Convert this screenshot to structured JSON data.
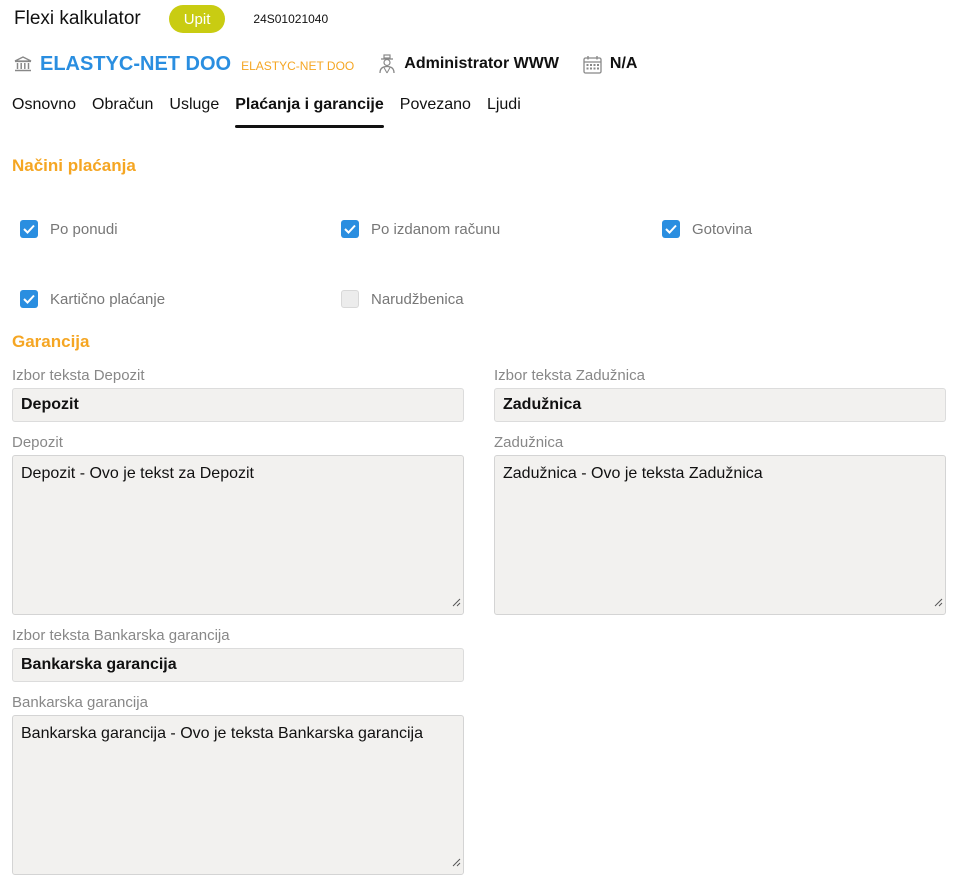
{
  "header": {
    "app_title": "Flexi kalkulator",
    "status_badge": "Upit",
    "doc_id": "24S01021040",
    "accent_color": "#c9cc12"
  },
  "company": {
    "name": "ELASTYC-NET DOO",
    "subtitle": "ELASTYC-NET DOO",
    "name_color": "#2a8ee0",
    "subtitle_color": "#f5a623",
    "user": "Administrator WWW",
    "date": "N/A",
    "icons": [
      "bank-icon",
      "user-icon",
      "calendar-icon"
    ]
  },
  "tabs": [
    {
      "label": "Osnovno",
      "active": false
    },
    {
      "label": "Obračun",
      "active": false
    },
    {
      "label": "Usluge",
      "active": false
    },
    {
      "label": "Plaćanja i garancije",
      "active": true
    },
    {
      "label": "Povezano",
      "active": false
    },
    {
      "label": "Ljudi",
      "active": false
    }
  ],
  "payment": {
    "title": "Načini plaćanja",
    "options": [
      {
        "label": "Po ponudi",
        "checked": true
      },
      {
        "label": "Po izdanom računu",
        "checked": true
      },
      {
        "label": "Gotovina",
        "checked": true
      },
      {
        "label": "Kartično plaćanje",
        "checked": true
      },
      {
        "label": "Narudžbenica",
        "checked": false
      }
    ]
  },
  "guarantee": {
    "title": "Garancija",
    "depozit_select_label": "Izbor teksta Depozit",
    "depozit_select_value": "Depozit",
    "depozit_label": "Depozit",
    "depozit_text": "Depozit - Ovo je tekst za Depozit",
    "zaduznica_select_label": "Izbor teksta Zadužnica",
    "zaduznica_select_value": "Zadužnica",
    "zaduznica_label": "Zadužnica",
    "zaduznica_text": "Zadužnica - Ovo je teksta Zadužnica",
    "bank_select_label": "Izbor teksta Bankarska garancija",
    "bank_select_value": "Bankarska garancija",
    "bank_label": "Bankarska garancija",
    "bank_text": "Bankarska garancija - Ovo je teksta Bankarska garancija"
  },
  "colors": {
    "section_title": "#f5a623",
    "checkbox_on": "#2a8ee0"
  }
}
